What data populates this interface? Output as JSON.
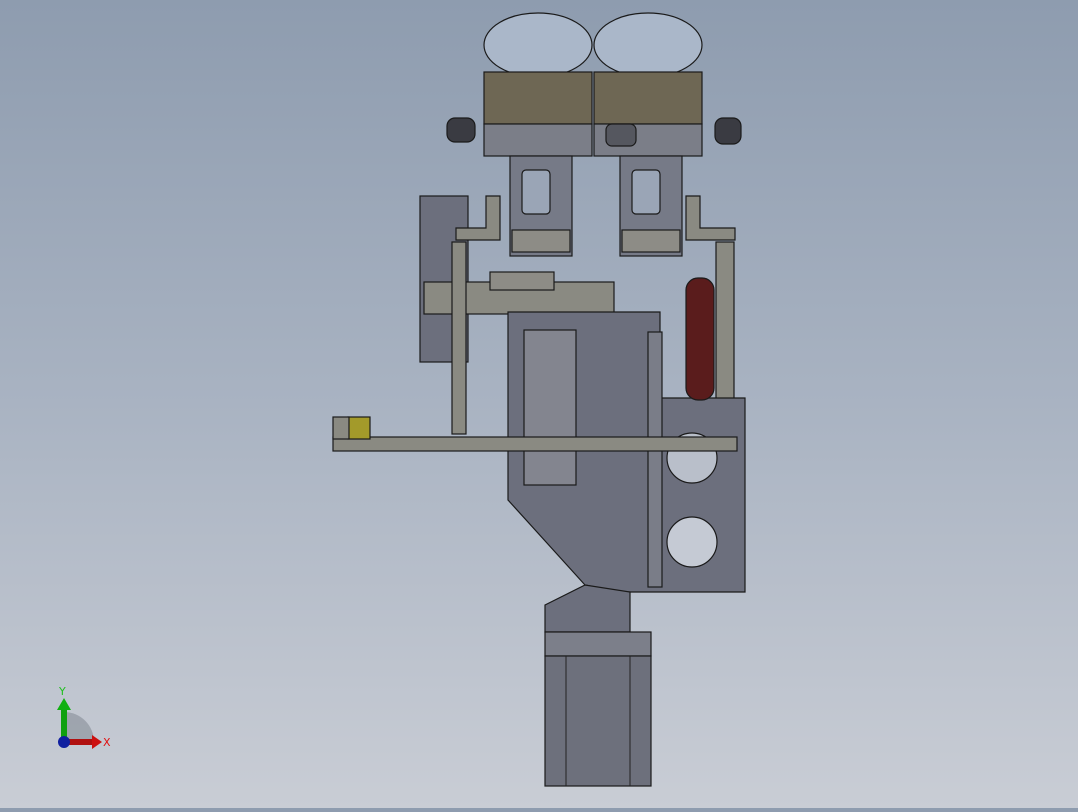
{
  "viewport": {
    "model": "mechanical-assembly",
    "view": "front",
    "background_top": "#8e9caf",
    "background_bottom": "#c9cdd5"
  },
  "triad": {
    "x_label": "X",
    "y_label": "Y",
    "x_color": "#cc1010",
    "y_color": "#10b010",
    "z_color": "#1020a0"
  },
  "colors": {
    "plate": "#6c6f7d",
    "frame": "#8a8a82",
    "cup_band": "#6e6754",
    "cup_dome": "#a9b6c8",
    "belt": "#5a1c1c",
    "block": "#a39a2a"
  }
}
